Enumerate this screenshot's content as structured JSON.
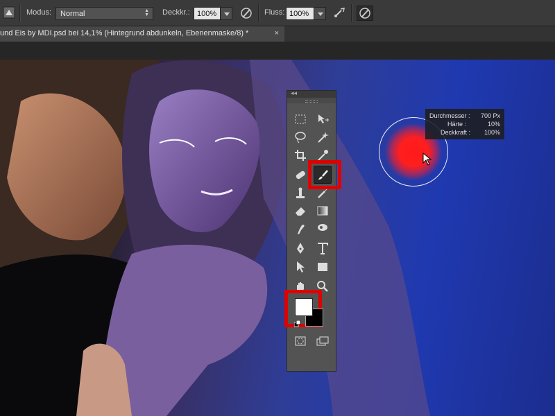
{
  "options_bar": {
    "mode_label": "Modus:",
    "mode_value": "Normal",
    "opacity_label": "Deckkr.:",
    "opacity_value": "100%",
    "flow_label": "Fluss:",
    "flow_value": "100%",
    "icons": [
      "brush-preset-icon",
      "pressure-opacity-icon",
      "airbrush-icon",
      "pressure-size-icon"
    ]
  },
  "document_tab": {
    "title": "und Eis by MDI.psd bei 14,1% (Hintegrund abdunkeln, Ebenenmaske/8) *",
    "close": "×"
  },
  "brush_hud": {
    "rows": [
      {
        "label": "Durchmesser :",
        "value": "700 Px"
      },
      {
        "label": "Härte :",
        "value": "10%"
      },
      {
        "label": "Deckkraft :",
        "value": "100%"
      }
    ]
  },
  "tool_panel": {
    "collapse": "◂◂",
    "tools": [
      "rectangular-marquee-tool",
      "move-tool",
      "lasso-tool",
      "magic-wand-tool",
      "crop-tool",
      "eyedropper-tool",
      "healing-brush-tool",
      "brush-tool",
      "clone-stamp-tool",
      "history-brush-tool",
      "eraser-tool",
      "gradient-tool",
      "smudge-tool",
      "dodge-tool",
      "pen-tool",
      "type-tool",
      "path-selection-tool",
      "rectangle-tool",
      "hand-tool",
      "zoom-tool",
      "quick-mask-icon",
      "screen-mode-icon"
    ],
    "active_tool": "brush-tool",
    "foreground_color": "#ffffff",
    "background_color": "#000000"
  },
  "colors": {
    "highlight": "#e00000",
    "brush_preview": "#ff1a1a"
  }
}
